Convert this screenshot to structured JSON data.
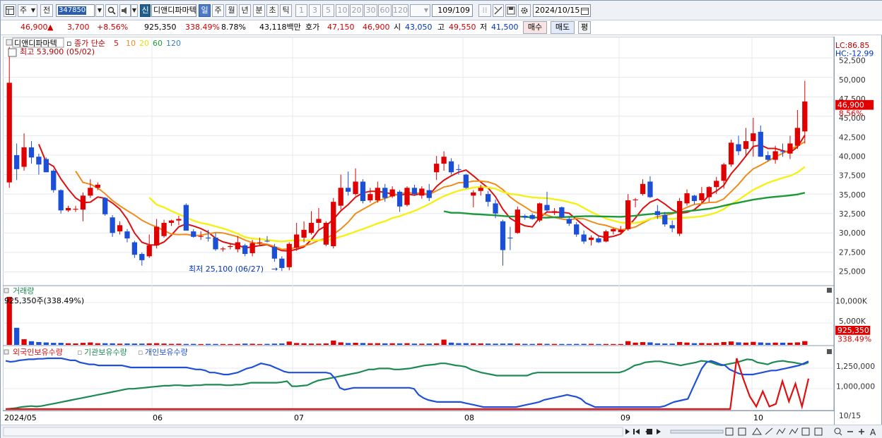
{
  "toolbar": {
    "type_label": "주",
    "prev_label": "전",
    "code": "347850",
    "new_badge": "신",
    "name": "디앤디파마텍",
    "periods": [
      "일",
      "주",
      "월",
      "년",
      "분",
      "초",
      "틱"
    ],
    "intervals": [
      "1",
      "3",
      "5",
      "10",
      "20",
      "30",
      "60",
      "120"
    ],
    "count": "109/109",
    "date": "2024/10/15"
  },
  "quote": {
    "price": "46,900",
    "arrow": "▲",
    "change": "3,700",
    "change_pct": "+8.56%",
    "volume": "925,350",
    "volume_ratio": "338.49%",
    "turnover": "8.78%",
    "amount": "43,118백만",
    "hoga_label": "호가",
    "ask": "47,150",
    "bid": "46,900",
    "open_label": "시",
    "open": "43,050",
    "high_label": "고",
    "high": "49,550",
    "low_label": "저",
    "low": "41,500",
    "buy_btn": "매수",
    "sell_btn": "매도",
    "eval_btn": "평"
  },
  "price_panel": {
    "name_tag": "디앤디파마텍",
    "ma_label": "종가 단순",
    "ma_periods": [
      "5",
      "10",
      "20",
      "60",
      "120"
    ],
    "ma_colors": [
      "#e01010",
      "#f08c1a",
      "#f5f015",
      "#1c9a3a",
      "#3c7cc8"
    ],
    "high_note": "최고 53,900 (05/02)",
    "low_note": "최저 25,100 (06/27)",
    "lc": "LC:86.85",
    "hc": "HC:-12.99",
    "last_price_tag": "46,900",
    "last_pct_tag": "8.56%",
    "y_ticks": [
      "52,500",
      "50,000",
      "47,500",
      "45,000",
      "42,500",
      "40,000",
      "37,500",
      "35,000",
      "32,500",
      "30,000",
      "27,500",
      "25,000"
    ]
  },
  "volume_panel": {
    "title": "거래량",
    "current": "925,350주(338.49%)",
    "y_ticks": [
      "10,000K",
      "5,000K"
    ],
    "last_tag": "925,350",
    "last_pct_tag": "338.49%"
  },
  "holdings_panel": {
    "legend": [
      "외국인보유수량",
      "기관보유수량",
      "개인보유수량"
    ],
    "legend_colors": [
      "#e01010",
      "#1c8a52",
      "#2050d8"
    ],
    "y_ticks": [
      "1,250,000",
      "1,000,000"
    ]
  },
  "x_axis": {
    "labels": [
      "2024/05",
      "06",
      "07",
      "08",
      "09",
      "10"
    ],
    "last_label": "10/15"
  },
  "chart_data": {
    "type": "candlestick",
    "unit": "KRW",
    "candles": [
      {
        "o": 36500,
        "h": 53900,
        "l": 35800,
        "c": 49300
      },
      {
        "o": 40000,
        "h": 41500,
        "l": 36800,
        "c": 38200
      },
      {
        "o": 38500,
        "h": 42800,
        "l": 38000,
        "c": 41000
      },
      {
        "o": 41000,
        "h": 41800,
        "l": 38900,
        "c": 39700
      },
      {
        "o": 39800,
        "h": 40200,
        "l": 37500,
        "c": 38800
      },
      {
        "o": 39500,
        "h": 39700,
        "l": 37800,
        "c": 37800
      },
      {
        "o": 38000,
        "h": 38200,
        "l": 35200,
        "c": 35500
      },
      {
        "o": 35500,
        "h": 35600,
        "l": 32500,
        "c": 32900
      },
      {
        "o": 32900,
        "h": 33500,
        "l": 32700,
        "c": 33200
      },
      {
        "o": 33000,
        "h": 33500,
        "l": 32700,
        "c": 33100
      },
      {
        "o": 33000,
        "h": 35200,
        "l": 31500,
        "c": 34800
      },
      {
        "o": 34800,
        "h": 36900,
        "l": 34500,
        "c": 35800
      },
      {
        "o": 35800,
        "h": 36500,
        "l": 35500,
        "c": 36200
      },
      {
        "o": 34500,
        "h": 34600,
        "l": 32200,
        "c": 32400
      },
      {
        "o": 32000,
        "h": 32300,
        "l": 29500,
        "c": 30000
      },
      {
        "o": 30200,
        "h": 31500,
        "l": 29800,
        "c": 31000
      },
      {
        "o": 30200,
        "h": 30500,
        "l": 28800,
        "c": 29300
      },
      {
        "o": 28800,
        "h": 29000,
        "l": 26800,
        "c": 27200
      },
      {
        "o": 27300,
        "h": 27500,
        "l": 25800,
        "c": 26500
      },
      {
        "o": 27000,
        "h": 29800,
        "l": 26800,
        "c": 28400
      },
      {
        "o": 28400,
        "h": 31800,
        "l": 28000,
        "c": 30800
      },
      {
        "o": 29600,
        "h": 31700,
        "l": 29400,
        "c": 31300
      },
      {
        "o": 31300,
        "h": 31700,
        "l": 30900,
        "c": 31600
      },
      {
        "o": 31600,
        "h": 32200,
        "l": 31000,
        "c": 31800
      },
      {
        "o": 33600,
        "h": 33800,
        "l": 30800,
        "c": 30300
      },
      {
        "o": 30200,
        "h": 30500,
        "l": 29400,
        "c": 29500
      },
      {
        "o": 29500,
        "h": 30200,
        "l": 29100,
        "c": 29600
      },
      {
        "o": 29400,
        "h": 30400,
        "l": 28900,
        "c": 29300
      },
      {
        "o": 29400,
        "h": 30000,
        "l": 27700,
        "c": 27900
      },
      {
        "o": 27900,
        "h": 28200,
        "l": 27600,
        "c": 28000
      },
      {
        "o": 28200,
        "h": 28600,
        "l": 27900,
        "c": 28300
      },
      {
        "o": 27900,
        "h": 29600,
        "l": 27500,
        "c": 28800
      },
      {
        "o": 28400,
        "h": 28600,
        "l": 27000,
        "c": 27300
      },
      {
        "o": 27400,
        "h": 29100,
        "l": 27000,
        "c": 28700
      },
      {
        "o": 28800,
        "h": 29400,
        "l": 28400,
        "c": 28800
      },
      {
        "o": 29000,
        "h": 29600,
        "l": 28800,
        "c": 28900
      },
      {
        "o": 28200,
        "h": 28600,
        "l": 26300,
        "c": 26700
      },
      {
        "o": 26700,
        "h": 27000,
        "l": 25100,
        "c": 25500
      },
      {
        "o": 25600,
        "h": 28800,
        "l": 25200,
        "c": 28600
      },
      {
        "o": 28100,
        "h": 31300,
        "l": 27700,
        "c": 29800
      },
      {
        "o": 29400,
        "h": 31500,
        "l": 28800,
        "c": 30400
      },
      {
        "o": 30000,
        "h": 32800,
        "l": 29800,
        "c": 31300
      },
      {
        "o": 31300,
        "h": 33200,
        "l": 30500,
        "c": 31800
      },
      {
        "o": 28500,
        "h": 31500,
        "l": 28300,
        "c": 31300
      },
      {
        "o": 28300,
        "h": 34500,
        "l": 28000,
        "c": 34000
      },
      {
        "o": 33500,
        "h": 37500,
        "l": 33000,
        "c": 35800
      },
      {
        "o": 35800,
        "h": 37900,
        "l": 34800,
        "c": 35300
      },
      {
        "o": 35000,
        "h": 38300,
        "l": 34800,
        "c": 36600
      },
      {
        "o": 36600,
        "h": 36900,
        "l": 33800,
        "c": 34100
      },
      {
        "o": 34200,
        "h": 35800,
        "l": 33900,
        "c": 35000
      },
      {
        "o": 34200,
        "h": 36600,
        "l": 33900,
        "c": 35800
      },
      {
        "o": 35800,
        "h": 36300,
        "l": 34000,
        "c": 34500
      },
      {
        "o": 34700,
        "h": 36000,
        "l": 34500,
        "c": 35600
      },
      {
        "o": 35300,
        "h": 35500,
        "l": 32700,
        "c": 33400
      },
      {
        "o": 33600,
        "h": 36000,
        "l": 33400,
        "c": 35800
      },
      {
        "o": 35800,
        "h": 36200,
        "l": 34800,
        "c": 35000
      },
      {
        "o": 34800,
        "h": 36000,
        "l": 34400,
        "c": 35700
      },
      {
        "o": 35500,
        "h": 36300,
        "l": 34100,
        "c": 34500
      },
      {
        "o": 37800,
        "h": 39900,
        "l": 36800,
        "c": 38900
      },
      {
        "o": 38900,
        "h": 40500,
        "l": 38000,
        "c": 39800
      },
      {
        "o": 39200,
        "h": 39600,
        "l": 37500,
        "c": 37800
      },
      {
        "o": 38200,
        "h": 38800,
        "l": 37500,
        "c": 38100
      },
      {
        "o": 37500,
        "h": 37600,
        "l": 35700,
        "c": 35800
      },
      {
        "o": 34800,
        "h": 35500,
        "l": 33300,
        "c": 35200
      },
      {
        "o": 35400,
        "h": 36200,
        "l": 34800,
        "c": 35800
      },
      {
        "o": 35000,
        "h": 35400,
        "l": 33400,
        "c": 34000
      },
      {
        "o": 33800,
        "h": 34300,
        "l": 31900,
        "c": 32500
      },
      {
        "o": 31500,
        "h": 31700,
        "l": 25800,
        "c": 27800
      },
      {
        "o": 29400,
        "h": 30800,
        "l": 27800,
        "c": 29300
      },
      {
        "o": 30000,
        "h": 33400,
        "l": 29900,
        "c": 33000
      },
      {
        "o": 32200,
        "h": 32400,
        "l": 31700,
        "c": 32000
      },
      {
        "o": 32300,
        "h": 32500,
        "l": 31700,
        "c": 31800
      },
      {
        "o": 31600,
        "h": 33900,
        "l": 31400,
        "c": 33800
      },
      {
        "o": 33600,
        "h": 35300,
        "l": 32700,
        "c": 32900
      },
      {
        "o": 32700,
        "h": 33200,
        "l": 32300,
        "c": 32800
      },
      {
        "o": 33300,
        "h": 33400,
        "l": 31900,
        "c": 32000
      },
      {
        "o": 31800,
        "h": 32100,
        "l": 30900,
        "c": 31200
      },
      {
        "o": 31100,
        "h": 31400,
        "l": 29500,
        "c": 29800
      },
      {
        "o": 29800,
        "h": 30300,
        "l": 28600,
        "c": 28900
      },
      {
        "o": 29100,
        "h": 29700,
        "l": 28400,
        "c": 29400
      },
      {
        "o": 29300,
        "h": 29600,
        "l": 28700,
        "c": 28800
      },
      {
        "o": 28900,
        "h": 30400,
        "l": 28800,
        "c": 30200
      },
      {
        "o": 30200,
        "h": 30600,
        "l": 29800,
        "c": 30500
      },
      {
        "o": 30100,
        "h": 30900,
        "l": 29900,
        "c": 30400
      },
      {
        "o": 30500,
        "h": 35000,
        "l": 30300,
        "c": 34200
      },
      {
        "o": 34200,
        "h": 34500,
        "l": 33300,
        "c": 34300
      },
      {
        "o": 35000,
        "h": 36900,
        "l": 34800,
        "c": 36300
      },
      {
        "o": 36600,
        "h": 37300,
        "l": 34500,
        "c": 34600
      },
      {
        "o": 32800,
        "h": 33600,
        "l": 31800,
        "c": 32300
      },
      {
        "o": 32300,
        "h": 32700,
        "l": 30800,
        "c": 31100
      },
      {
        "o": 31000,
        "h": 31600,
        "l": 30100,
        "c": 30600
      },
      {
        "o": 29900,
        "h": 34500,
        "l": 29600,
        "c": 34100
      },
      {
        "o": 33800,
        "h": 35600,
        "l": 33500,
        "c": 35100
      },
      {
        "o": 34800,
        "h": 34900,
        "l": 33700,
        "c": 34100
      },
      {
        "o": 34200,
        "h": 35900,
        "l": 33800,
        "c": 35100
      },
      {
        "o": 34600,
        "h": 36000,
        "l": 34000,
        "c": 35900
      },
      {
        "o": 35900,
        "h": 37200,
        "l": 35000,
        "c": 36700
      },
      {
        "o": 36700,
        "h": 39000,
        "l": 35700,
        "c": 38800
      },
      {
        "o": 38800,
        "h": 42000,
        "l": 38500,
        "c": 41600
      },
      {
        "o": 41400,
        "h": 42500,
        "l": 40000,
        "c": 40500
      },
      {
        "o": 40800,
        "h": 43500,
        "l": 39800,
        "c": 41800
      },
      {
        "o": 41800,
        "h": 44800,
        "l": 39800,
        "c": 42800
      },
      {
        "o": 43000,
        "h": 43800,
        "l": 39800,
        "c": 39800
      },
      {
        "o": 40000,
        "h": 40500,
        "l": 39200,
        "c": 39400
      },
      {
        "o": 39400,
        "h": 41200,
        "l": 38900,
        "c": 40500
      },
      {
        "o": 40500,
        "h": 41500,
        "l": 39800,
        "c": 40400
      },
      {
        "o": 40200,
        "h": 42500,
        "l": 39500,
        "c": 41500
      },
      {
        "o": 41200,
        "h": 45800,
        "l": 40800,
        "c": 43500
      },
      {
        "o": 43050,
        "h": 49550,
        "l": 41500,
        "c": 46900
      }
    ],
    "volume_k": [
      11800,
      4200,
      1400,
      900,
      700,
      600,
      500,
      500,
      400,
      350,
      500,
      600,
      400,
      400,
      380,
      300,
      350,
      330,
      320,
      360,
      420,
      320,
      250,
      280,
      230,
      250,
      210,
      250,
      230,
      220,
      210,
      230,
      320,
      280,
      210,
      250,
      310,
      360,
      820,
      460,
      380,
      320,
      300,
      360,
      1060,
      620,
      460,
      520,
      460,
      400,
      420,
      380,
      400,
      380,
      420,
      310,
      290,
      330,
      370,
      1300,
      560,
      420,
      420,
      380,
      360,
      330,
      300,
      320,
      360,
      300,
      260,
      240,
      310,
      260,
      240,
      230,
      220,
      240,
      260,
      260,
      220,
      230,
      220,
      220,
      920,
      560,
      680,
      620,
      380,
      330,
      310,
      700,
      580,
      410,
      460,
      400,
      480,
      700,
      840,
      620,
      560,
      740,
      600,
      480,
      560,
      540,
      520,
      620,
      925
    ],
    "holdings": {
      "foreign_pct": [
        0,
        0,
        0,
        0,
        0,
        0,
        0,
        0,
        0,
        0,
        0,
        0,
        0,
        0,
        0,
        0,
        0,
        0,
        0,
        0,
        0,
        0,
        0,
        0,
        0,
        0,
        0,
        0,
        0,
        0,
        0,
        0,
        0,
        0,
        0,
        0,
        0,
        0,
        0,
        0,
        0,
        0,
        0,
        0,
        0,
        0,
        0,
        0,
        0,
        0,
        0,
        0,
        0,
        0,
        0,
        0,
        0,
        0,
        0,
        0,
        0,
        0,
        0,
        0,
        0,
        0,
        0,
        0,
        0,
        0,
        0,
        0,
        0,
        0,
        0,
        0,
        0,
        0,
        0,
        0,
        0,
        0,
        0,
        0,
        0,
        0,
        0,
        0,
        0,
        0,
        0,
        0,
        0,
        0,
        0,
        0,
        0,
        0,
        0,
        0,
        0,
        0,
        0,
        0,
        0,
        0,
        0,
        0,
        0,
        0,
        0,
        0,
        100,
        60,
        25,
        5,
        35,
        5,
        10,
        55,
        15,
        50,
        5,
        60
      ],
      "institution_pct": [
        0,
        1,
        2,
        4,
        5,
        6,
        5,
        6,
        8,
        10,
        12,
        14,
        16,
        18,
        20,
        22,
        24,
        26,
        28,
        30,
        32,
        34,
        36,
        38,
        40,
        40,
        41,
        42,
        43,
        44,
        45,
        46,
        46,
        47,
        47,
        46,
        46,
        47,
        47,
        48,
        48,
        48,
        48,
        47,
        47,
        48,
        48,
        50,
        52,
        52,
        52,
        52,
        52,
        52,
        53,
        55,
        45,
        45,
        46,
        47,
        52,
        56,
        58,
        60,
        62,
        64,
        66,
        68,
        70,
        72,
        75,
        78,
        78,
        80,
        80,
        80,
        78,
        78,
        79,
        80,
        82,
        84,
        86,
        87,
        88,
        90,
        90,
        88,
        86,
        85,
        83,
        78,
        75,
        72,
        70,
        68,
        66,
        66,
        66,
        66,
        66,
        66,
        66,
        70,
        72,
        72,
        72,
        72,
        72,
        72,
        72,
        72,
        72,
        72,
        72,
        72,
        72,
        72,
        72,
        72,
        72,
        75,
        80,
        86,
        88,
        92,
        93,
        94,
        94,
        92,
        90,
        88,
        86,
        88,
        90,
        92,
        95,
        94,
        92,
        88,
        86,
        88,
        90,
        92,
        95,
        98,
        97,
        92,
        90,
        88,
        92,
        94,
        95,
        93,
        92,
        90,
        88,
        92
      ],
      "individual_pct": [
        95,
        93,
        94,
        96,
        97,
        98,
        98,
        99,
        99,
        100,
        100,
        100,
        100,
        98,
        96,
        96,
        92,
        90,
        88,
        88,
        86,
        86,
        86,
        86,
        86,
        86,
        84,
        82,
        82,
        82,
        82,
        82,
        82,
        82,
        82,
        82,
        82,
        82,
        82,
        82,
        80,
        78,
        78,
        76,
        72,
        72,
        70,
        68,
        68,
        70,
        72,
        76,
        80,
        82,
        86,
        90,
        88,
        86,
        82,
        78,
        74,
        72,
        72,
        72,
        72,
        72,
        72,
        72,
        72,
        72,
        70,
        60,
        42,
        38,
        40,
        42,
        42,
        42,
        42,
        42,
        42,
        42,
        42,
        42,
        42,
        42,
        42,
        42,
        40,
        28,
        22,
        18,
        16,
        14,
        14,
        14,
        14,
        14,
        14,
        12,
        10,
        8,
        6,
        4,
        4,
        4,
        4,
        4,
        4,
        4,
        4,
        6,
        8,
        10,
        12,
        14,
        18,
        20,
        22,
        24,
        26,
        28,
        26,
        24,
        20,
        12,
        8,
        4,
        4,
        4,
        4,
        4,
        4,
        4,
        4,
        4,
        4,
        4,
        4,
        4,
        4,
        4,
        6,
        10,
        14,
        16,
        18,
        20,
        40,
        60,
        80,
        92,
        95,
        92,
        88,
        86,
        78,
        74,
        70,
        68,
        68,
        68,
        70,
        72,
        74,
        76,
        76,
        78,
        80,
        82,
        84,
        86,
        90,
        94
      ]
    },
    "y_range": [
      23500,
      54500
    ],
    "x_labels": [
      "2024/05",
      "06",
      "07",
      "08",
      "09",
      "10"
    ]
  }
}
